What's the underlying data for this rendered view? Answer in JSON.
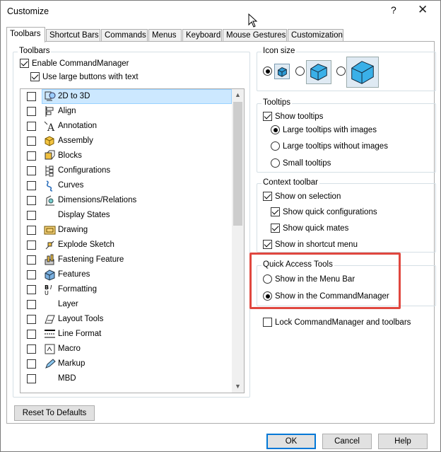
{
  "window": {
    "title": "Customize",
    "help_glyph": "?",
    "close_glyph": "✕"
  },
  "tabs": [
    {
      "label": "Toolbars",
      "active": true
    },
    {
      "label": "Shortcut Bars"
    },
    {
      "label": "Commands"
    },
    {
      "label": "Menus"
    },
    {
      "label": "Keyboard"
    },
    {
      "label": "Mouse Gestures"
    },
    {
      "label": "Customization"
    }
  ],
  "toolbars_group": {
    "title": "Toolbars",
    "enable_commandmanager": {
      "label": "Enable CommandManager",
      "checked": true
    },
    "use_large_buttons": {
      "label": "Use large buttons with text",
      "checked": true
    },
    "items": [
      {
        "label": "2D to 3D",
        "icon": "2d-to-3d-icon",
        "checked": false,
        "selected": true
      },
      {
        "label": "Align",
        "icon": "align-icon",
        "checked": false
      },
      {
        "label": "Annotation",
        "icon": "annotation-icon",
        "checked": false
      },
      {
        "label": "Assembly",
        "icon": "assembly-icon",
        "checked": false
      },
      {
        "label": "Blocks",
        "icon": "blocks-icon",
        "checked": false
      },
      {
        "label": "Configurations",
        "icon": "configurations-icon",
        "checked": false
      },
      {
        "label": "Curves",
        "icon": "curves-icon",
        "checked": false
      },
      {
        "label": "Dimensions/Relations",
        "icon": "dimensions-icon",
        "checked": false
      },
      {
        "label": "Display States",
        "icon": "",
        "checked": false
      },
      {
        "label": "Drawing",
        "icon": "drawing-icon",
        "checked": false
      },
      {
        "label": "Explode Sketch",
        "icon": "explode-sketch-icon",
        "checked": false
      },
      {
        "label": "Fastening Feature",
        "icon": "fastening-feature-icon",
        "checked": false
      },
      {
        "label": "Features",
        "icon": "features-icon",
        "checked": false
      },
      {
        "label": "Formatting",
        "icon": "formatting-icon",
        "checked": false
      },
      {
        "label": "Layer",
        "icon": "",
        "checked": false
      },
      {
        "label": "Layout Tools",
        "icon": "layout-tools-icon",
        "checked": false
      },
      {
        "label": "Line Format",
        "icon": "line-format-icon",
        "checked": false
      },
      {
        "label": "Macro",
        "icon": "macro-icon",
        "checked": false
      },
      {
        "label": "Markup",
        "icon": "markup-icon",
        "checked": false
      },
      {
        "label": "MBD",
        "icon": "",
        "checked": false
      }
    ]
  },
  "icon_size": {
    "title": "Icon size",
    "options": [
      {
        "size": "small",
        "selected": true
      },
      {
        "size": "medium",
        "selected": false
      },
      {
        "size": "large",
        "selected": false
      }
    ]
  },
  "tooltips": {
    "title": "Tooltips",
    "show_tooltips": {
      "label": "Show tooltips",
      "checked": true
    },
    "options": [
      {
        "label": "Large tooltips with images",
        "selected": true
      },
      {
        "label": "Large tooltips without images",
        "selected": false
      },
      {
        "label": "Small tooltips",
        "selected": false
      }
    ]
  },
  "context_toolbar": {
    "title": "Context toolbar",
    "show_on_selection": {
      "label": "Show on selection",
      "checked": true
    },
    "show_quick_configurations": {
      "label": "Show quick configurations",
      "checked": true
    },
    "show_quick_mates": {
      "label": "Show quick mates",
      "checked": true
    },
    "show_in_shortcut_menu": {
      "label": "Show in shortcut menu",
      "checked": true
    }
  },
  "quick_access": {
    "title": "Quick Access Tools",
    "options": [
      {
        "label": "Show in the Menu Bar",
        "selected": false
      },
      {
        "label": "Show in the CommandManager",
        "selected": true
      }
    ]
  },
  "lock": {
    "label": "Lock CommandManager and toolbars",
    "checked": false
  },
  "buttons": {
    "reset": "Reset To Defaults",
    "ok": "OK",
    "cancel": "Cancel",
    "help": "Help"
  },
  "colors": {
    "selection": "#cce8ff",
    "highlight_box": "#e0473f",
    "default_button_border": "#0078d7"
  }
}
